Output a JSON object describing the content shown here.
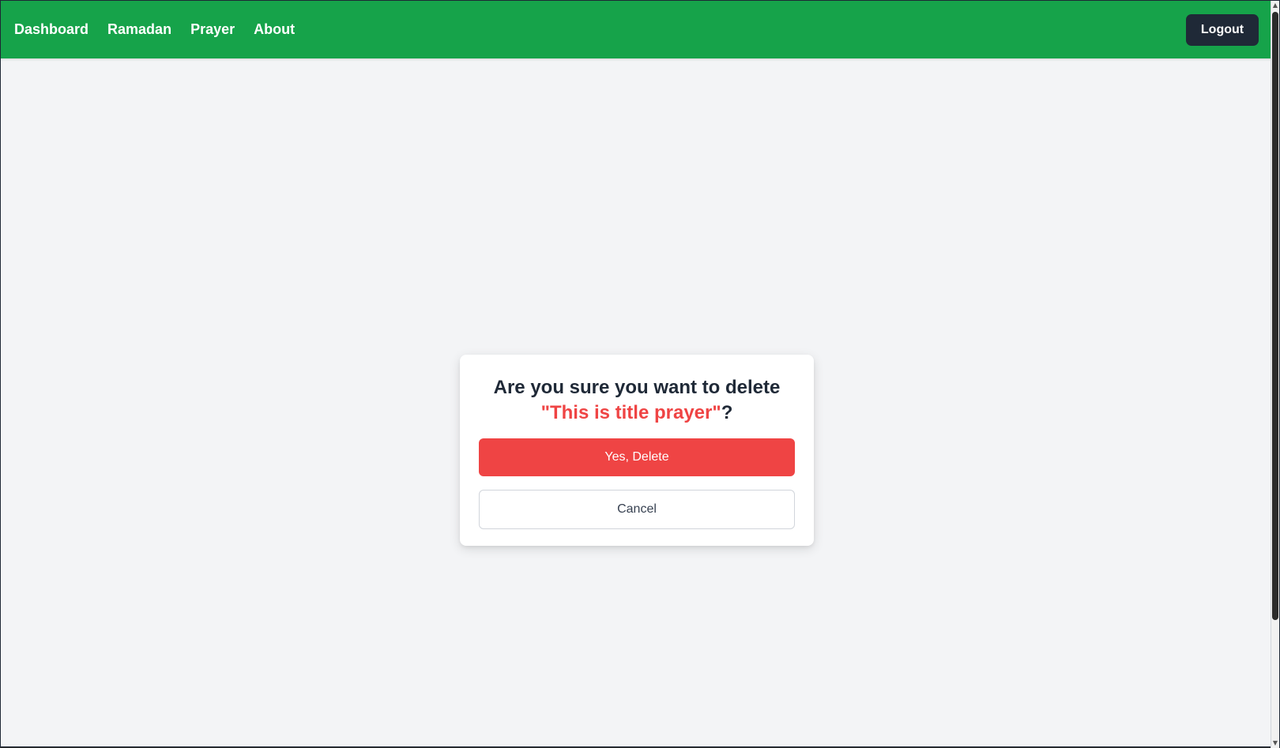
{
  "nav": {
    "links": [
      "Dashboard",
      "Ramadan",
      "Prayer",
      "About"
    ],
    "logout_label": "Logout"
  },
  "modal": {
    "question": "Are you sure you want to delete",
    "item_name": "\"This is title prayer\"",
    "question_suffix": "?",
    "confirm_label": "Yes, Delete",
    "cancel_label": "Cancel"
  },
  "colors": {
    "nav_bg": "#16a34a",
    "danger": "#ef4444",
    "dark_button": "#1f2937",
    "page_bg": "#f3f4f6"
  }
}
